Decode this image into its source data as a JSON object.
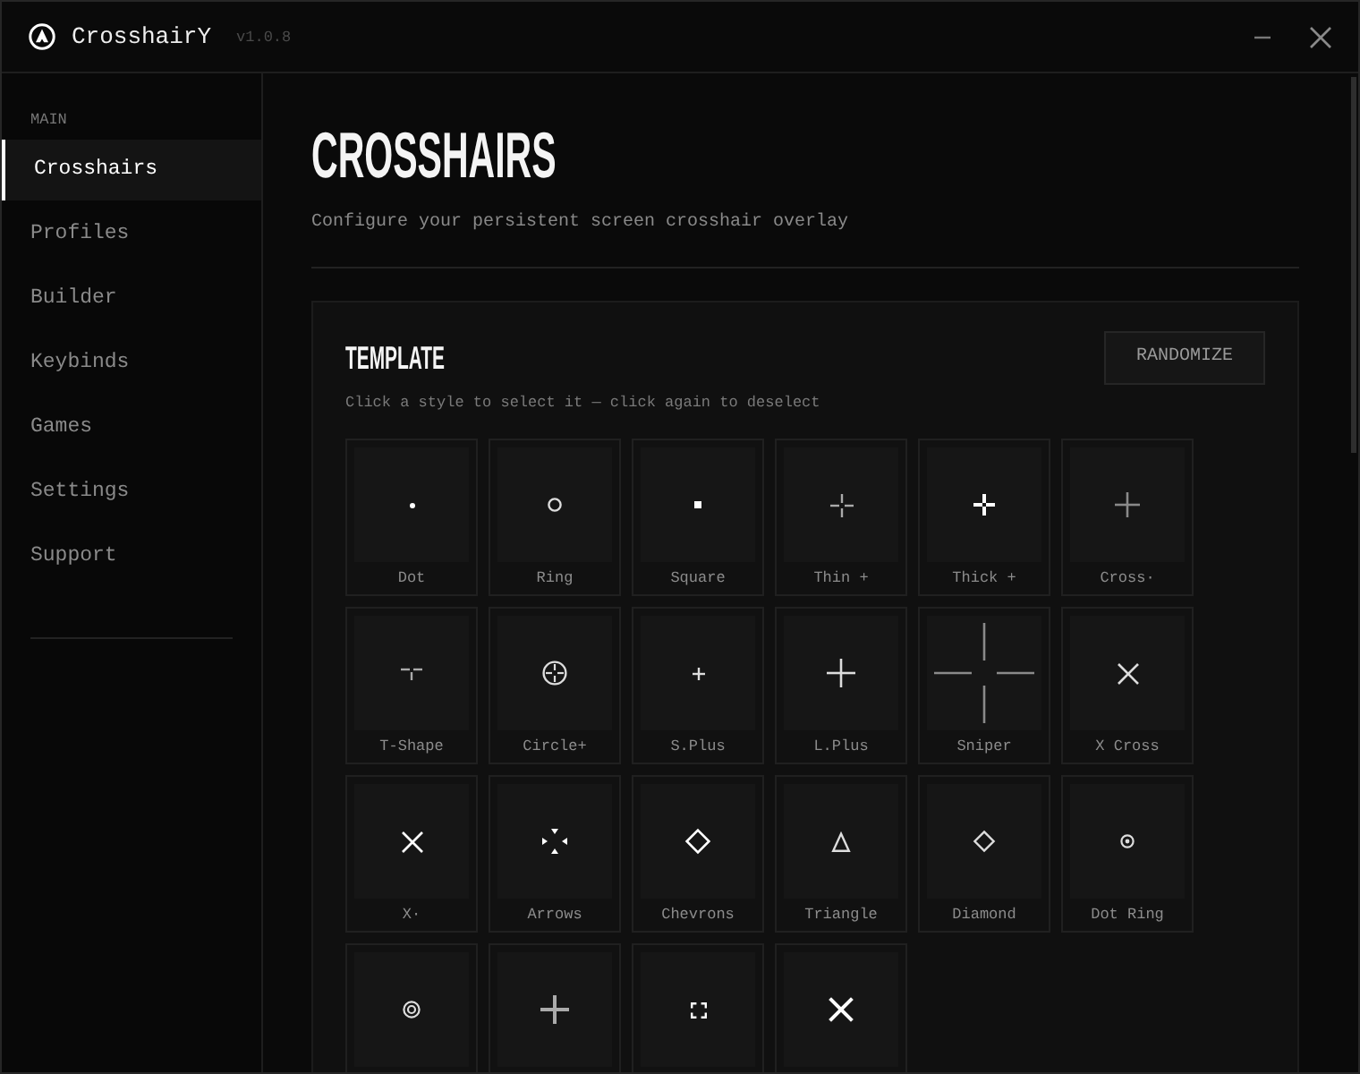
{
  "window": {
    "title": "CrosshairY",
    "version": "v1.0.8"
  },
  "sidebar": {
    "section_label": "MAIN",
    "items": [
      {
        "label": "Crosshairs",
        "selected": true
      },
      {
        "label": "Profiles",
        "selected": false
      },
      {
        "label": "Builder",
        "selected": false
      },
      {
        "label": "Keybinds",
        "selected": false
      },
      {
        "label": "Games",
        "selected": false
      },
      {
        "label": "Settings",
        "selected": false
      },
      {
        "label": "Support",
        "selected": false
      }
    ]
  },
  "page": {
    "title": "CROSSHAIRS",
    "subtitle": "Configure your persistent screen crosshair overlay"
  },
  "template": {
    "title": "TEMPLATE",
    "button": "RANDOMIZE",
    "hint": "Click a style to select it — click again to deselect",
    "styles": [
      {
        "kind": "dot",
        "label": "Dot",
        "selected": false
      },
      {
        "kind": "ring",
        "label": "Ring",
        "selected": false
      },
      {
        "kind": "square",
        "label": "Square",
        "selected": false
      },
      {
        "kind": "thin-plus",
        "label": "Thin +",
        "selected": false
      },
      {
        "kind": "thick-plus",
        "label": "Thick +",
        "selected": false
      },
      {
        "kind": "cross-dot",
        "label": "Cross·",
        "selected": false
      },
      {
        "kind": "t-shape",
        "label": "T-Shape",
        "selected": false
      },
      {
        "kind": "circle-plus",
        "label": "Circle+",
        "selected": false
      },
      {
        "kind": "small-plus",
        "label": "S.Plus",
        "selected": false
      },
      {
        "kind": "large-plus",
        "label": "L.Plus",
        "selected": false
      },
      {
        "kind": "sniper",
        "label": "Sniper",
        "selected": false
      },
      {
        "kind": "x-cross",
        "label": "X Cross",
        "selected": false
      },
      {
        "kind": "x-dot",
        "label": "X·",
        "selected": false
      },
      {
        "kind": "arrows",
        "label": "Arrows",
        "selected": false
      },
      {
        "kind": "chevrons",
        "label": "Chevrons",
        "selected": false
      },
      {
        "kind": "triangle",
        "label": "Triangle",
        "selected": false
      },
      {
        "kind": "diamond",
        "label": "Diamond",
        "selected": false
      },
      {
        "kind": "dot-ring",
        "label": "Dot Ring",
        "selected": false
      },
      {
        "kind": "bullseye",
        "selected": false
      },
      {
        "kind": "bold-plus",
        "selected": false
      },
      {
        "kind": "bracket",
        "selected": false
      },
      {
        "kind": "big-x",
        "selected": false
      }
    ]
  }
}
